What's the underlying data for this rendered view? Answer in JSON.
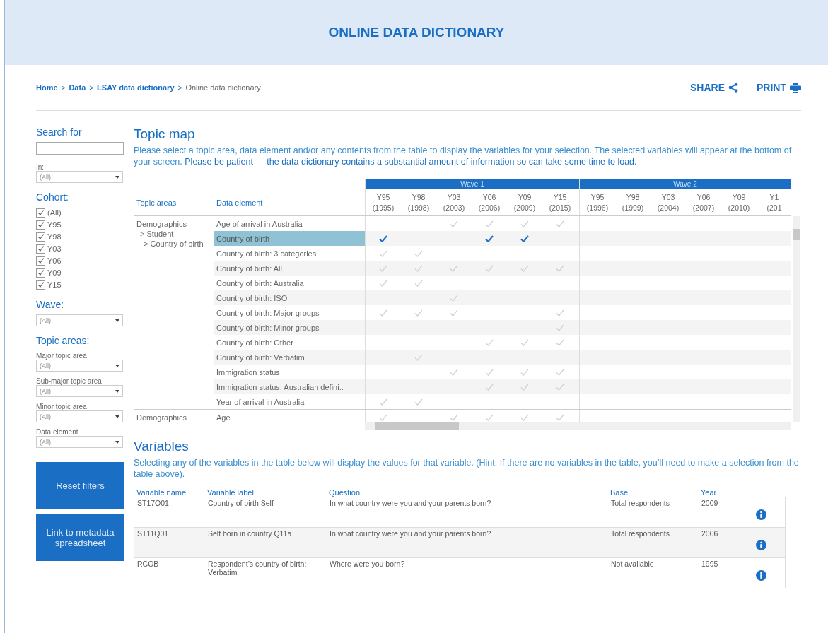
{
  "header": {
    "title": "ONLINE DATA DICTIONARY"
  },
  "breadcrumb": [
    {
      "label": "Home",
      "link": true
    },
    {
      "label": "Data",
      "link": true
    },
    {
      "label": "LSAY data dictionary",
      "link": true
    },
    {
      "label": "Online data dictionary",
      "link": false
    }
  ],
  "breadcrumb_separator": ">",
  "actions": [
    "SHARE",
    "PRINT"
  ],
  "sidebar": {
    "search_label": "Search for",
    "in_label": "In:",
    "in_value": "(All)",
    "cohort_label": "Cohort:",
    "cohorts": [
      {
        "label": "(All)",
        "checked": true
      },
      {
        "label": "Y95",
        "checked": true
      },
      {
        "label": "Y98",
        "checked": true
      },
      {
        "label": "Y03",
        "checked": true
      },
      {
        "label": "Y06",
        "checked": true
      },
      {
        "label": "Y09",
        "checked": true
      },
      {
        "label": "Y15",
        "checked": true
      }
    ],
    "wave_label": "Wave:",
    "wave_value": "(All)",
    "topic_label": "Topic areas:",
    "filters": [
      {
        "label": "Major topic area",
        "value": "(All)"
      },
      {
        "label": "Sub-major topic area",
        "value": "(All)"
      },
      {
        "label": "Minor topic area",
        "value": "(All)"
      },
      {
        "label": "Data element",
        "value": "(All)"
      }
    ],
    "buttons": [
      "Reset filters",
      "Link to metadata spreadsheet"
    ]
  },
  "topic_map": {
    "title": "Topic map",
    "intro": "Please select a topic area, data element and/or any contents from the table to display the variables for your selection. The selected variables will appear at the bottom of your screen. ",
    "intro_bold": "Please be patient — the data dictionary contains a substantial amount of information so can take some time to load.",
    "columns": [
      "Topic areas",
      "Data element"
    ],
    "waves": [
      {
        "label": "Wave 1",
        "years": [
          [
            "Y95",
            "(1995)"
          ],
          [
            "Y98",
            "(1998)"
          ],
          [
            "Y03",
            "(2003)"
          ],
          [
            "Y06",
            "(2006)"
          ],
          [
            "Y09",
            "(2009)"
          ],
          [
            "Y15",
            "(2015)"
          ]
        ]
      },
      {
        "label": "Wave 2",
        "years": [
          [
            "Y95",
            "(1996)"
          ],
          [
            "Y98",
            "(1999)"
          ],
          [
            "Y03",
            "(2004)"
          ],
          [
            "Y06",
            "(2007)"
          ],
          [
            "Y09",
            "(2010)"
          ],
          [
            "Y1",
            "(201"
          ]
        ]
      }
    ],
    "groups": [
      {
        "topic": [
          "Demographics",
          "> Student",
          "> Country of birth"
        ],
        "rows": [
          {
            "element": "Age of arrival in Australia",
            "selected": false,
            "checks": [
              false,
              false,
              true,
              true,
              true,
              true
            ]
          },
          {
            "element": "Country of birth",
            "selected": true,
            "checks": [
              true,
              false,
              false,
              true,
              true,
              false
            ]
          },
          {
            "element": "Country of birth: 3 categories",
            "selected": false,
            "checks": [
              true,
              true,
              false,
              false,
              false,
              false
            ]
          },
          {
            "element": "Country of birth: All",
            "selected": false,
            "checks": [
              true,
              true,
              true,
              true,
              true,
              true
            ]
          },
          {
            "element": "Country of birth: Australia",
            "selected": false,
            "checks": [
              true,
              true,
              false,
              false,
              false,
              false
            ]
          },
          {
            "element": "Country of birth: ISO",
            "selected": false,
            "checks": [
              false,
              false,
              true,
              false,
              false,
              false
            ]
          },
          {
            "element": "Country of birth: Major groups",
            "selected": false,
            "checks": [
              true,
              true,
              true,
              false,
              false,
              true
            ]
          },
          {
            "element": "Country of birth: Minor groups",
            "selected": false,
            "checks": [
              false,
              false,
              false,
              false,
              false,
              true
            ]
          },
          {
            "element": "Country of birth: Other",
            "selected": false,
            "checks": [
              false,
              false,
              false,
              true,
              true,
              true
            ]
          },
          {
            "element": "Country of birth: Verbatim",
            "selected": false,
            "checks": [
              false,
              true,
              false,
              false,
              false,
              false
            ]
          },
          {
            "element": "Immigration status",
            "selected": false,
            "checks": [
              false,
              false,
              true,
              true,
              true,
              true
            ]
          },
          {
            "element": "Immigration status: Australian defini..",
            "selected": false,
            "checks": [
              false,
              false,
              false,
              true,
              true,
              true
            ]
          },
          {
            "element": "Year of arrival in Australia",
            "selected": false,
            "checks": [
              true,
              true,
              false,
              false,
              false,
              false
            ]
          }
        ]
      },
      {
        "topic": [
          "Demographics"
        ],
        "rows": [
          {
            "element": "Age",
            "selected": false,
            "checks": [
              true,
              false,
              true,
              true,
              true,
              true
            ]
          }
        ]
      }
    ]
  },
  "variables": {
    "title": "Variables",
    "intro": "Selecting any of the variables in the table below will display the values for that variable. (Hint: If there are no variables in the table, you’ll need to make a selection from the table above).",
    "columns": [
      "Variable name",
      "Variable label",
      "Question",
      "Base",
      "Year"
    ],
    "rows": [
      [
        "ST17Q01",
        "Country of birth Self",
        "In what country were you and your parents born?",
        "Total respondents",
        "2009"
      ],
      [
        "ST11Q01",
        "Self born in country Q11a",
        "In what country were you and your parents born?",
        "Total respondents",
        "2006"
      ],
      [
        "RCOB",
        "Respondent’s country of birth: Verbatim",
        "Where were you born?",
        "Not available",
        "1995"
      ]
    ]
  }
}
